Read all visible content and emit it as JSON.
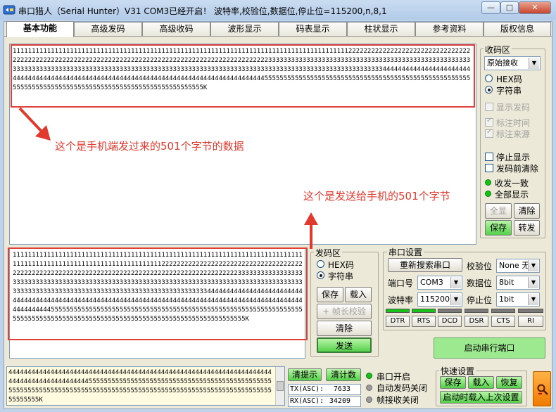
{
  "window": {
    "title": "串口猎人（Serial Hunter）V31   COM3已经开启！ 波特率,校验位,数据位,停止位=115200,n,8,1",
    "buttons": {
      "minimize": "—",
      "maximize": "□",
      "close": "✕"
    }
  },
  "tabs": [
    "基本功能",
    "高级发码",
    "高级收码",
    "波形显示",
    "码表显示",
    "柱状显示",
    "参考资料",
    "版权信息"
  ],
  "receive_area": {
    "text": "11111111111111111111111111111111111111111111111111111111111111111111111111111111111111112222222222222222222222222222222222222222222222222222222222222222222222222222222222222222222222222223333333333333333333333333333333333333333333333333333333333333333333333333333333333333333333333333333333333333333333333333333333333333333333333333333334444444444444444444444444444444444444444444444444444444444444444444444444444444444444444455555555555555555555555555555555555555555555555555555555555555555555555555555555555555555555555555555555K"
  },
  "send_area": {
    "text": "11111111111111111111111111111111111111111111111111111111111111111111111111111111111111111111111111111111111111111112222222222222222222222222222222222222222222222222222222222222222222222222222222222222222222222223333333333333333333333333333333333333333333333333333333333333333333333333333333333333333333333333333333333333333333333333333333333333333333333334444444444444444444444444444444444444444444444444444444444444444444444444444444444444444444444444444444444444445555555555555555555555555555555555555555555555555555555555555555555555555555555555555555555555555555555555555555555555555555555K"
  },
  "annotations": {
    "receive_note": "这个是手机端发过来的501个字节的数据",
    "send_note": "这个是发送给手机的501个字节"
  },
  "receive_group": {
    "title": "收码区",
    "mode_select": "原始接收",
    "radio_hex": "HEX码",
    "radio_string": "字符串",
    "show_sent": "显示发码",
    "mark_time": "标注时间",
    "mark_source": "标注来源",
    "stop_display": "停止显示",
    "clear_before_send": "发码前清除",
    "send_recv_consistent": "收发一致",
    "show_all": "全部显示",
    "btn_select_all": "全显",
    "btn_clear": "清除",
    "btn_save": "保存",
    "btn_convert": "转发"
  },
  "send_group": {
    "title": "发码区",
    "radio_hex": "HEX码",
    "radio_string": "字符串",
    "btn_save": "保存",
    "btn_load": "载入",
    "btn_frame_check": "+ 帧长校验",
    "btn_clear": "清除",
    "btn_send": "发送"
  },
  "serial_settings": {
    "title": "串口设置",
    "btn_rescan": "重新搜索串口",
    "label_parity": "校验位",
    "parity_value": "None 无",
    "label_port": "端口号",
    "port_value": "COM3",
    "label_databits": "数据位",
    "databits_value": "8bit",
    "label_baud": "波特率",
    "baud_value": "115200",
    "label_stopbits": "停止位",
    "stopbits_value": "1bit",
    "signals": [
      "DTR",
      "RTS",
      "DCD",
      "DSR",
      "CTS",
      "RI"
    ],
    "btn_start": "启动串行端口"
  },
  "history": {
    "text": "44444444444444444444444444444444444444444444444444444444444444444444444444444444444444444455555555555555555555555555555555555555555555555555555555555555555555555555555555555555555555555555555555555555555555555555555K"
  },
  "status": {
    "btn_clear_hint": "清提示",
    "btn_clear_count": "清计数",
    "tx_label": "TX(ASC):",
    "tx_value": "7633",
    "rx_label": "RX(ASC):",
    "rx_value": "34209",
    "port_open": "串口开启",
    "auto_send_off": "自动发码关闭",
    "frame_recv_off": "帧接收关闭"
  },
  "quick_settings": {
    "title": "快速设置",
    "btn_save": "保存",
    "btn_load": "载入",
    "btn_restore": "恢复",
    "btn_load_last": "启动时载入上次设置"
  },
  "colors": {
    "annotation": "#e03a2e",
    "led_green": "#16c21a",
    "start_button": "#9ce98f"
  }
}
